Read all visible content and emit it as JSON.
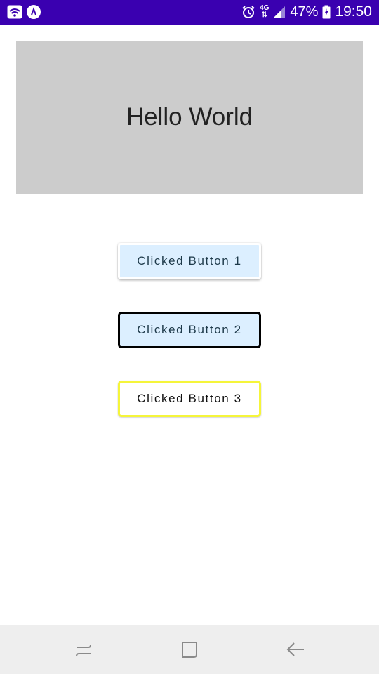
{
  "status_bar": {
    "network_type": "4G",
    "battery_percent": "47%",
    "time": "19:50",
    "background_color": "#3a00b0",
    "icons": [
      "wifi-icon",
      "app-notification-icon",
      "alarm-icon",
      "data-arrows-icon",
      "signal-icon",
      "battery-charging-icon"
    ]
  },
  "banner": {
    "text": "Hello World",
    "background_color": "#cccccc"
  },
  "buttons": [
    {
      "label": "Clicked Button 1",
      "style": "raised",
      "background_color": "#dcefff",
      "border_color": "#ffffff"
    },
    {
      "label": "Clicked Button 2",
      "style": "outlined",
      "background_color": "#dcefff",
      "border_color": "#000000"
    },
    {
      "label": "Clicked Button 3",
      "style": "outlined",
      "background_color": "#ffffff",
      "border_color": "#f5f53a"
    }
  ],
  "nav_bar": {
    "icons": [
      "recent-apps-icon",
      "home-icon",
      "back-icon"
    ],
    "background_color": "#eeeeee"
  }
}
